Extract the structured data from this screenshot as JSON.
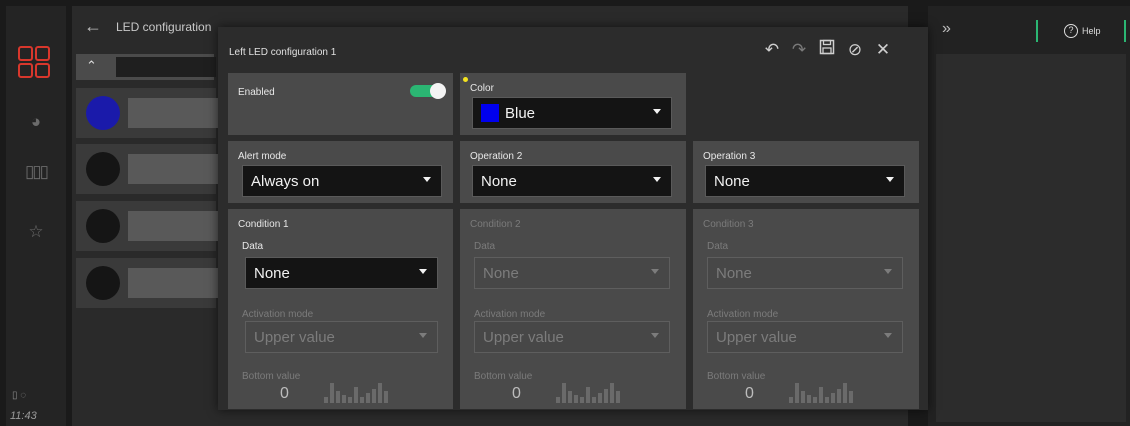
{
  "rail": {
    "clock": "11:43",
    "status": "▯ ◌"
  },
  "background": {
    "title": "LED configuration",
    "led_colors": [
      "#1a1aaa",
      "#151515",
      "#151515",
      "#151515"
    ]
  },
  "right_panel": {
    "help_label": "Help"
  },
  "modal": {
    "title": "Left LED configuration 1",
    "enabled": {
      "label": "Enabled",
      "value": true
    },
    "color": {
      "label": "Color",
      "value": "Blue",
      "swatch": "#0000ee"
    },
    "alert_mode": {
      "label": "Alert mode",
      "value": "Always on"
    },
    "operation2": {
      "label": "Operation 2",
      "value": "None"
    },
    "operation3": {
      "label": "Operation 3",
      "value": "None"
    },
    "conditions": [
      {
        "title": "Condition 1",
        "data_label": "Data",
        "data_value": "None",
        "activation_label": "Activation mode",
        "activation_value": "Upper value",
        "bottom_label": "Bottom value",
        "bottom_value": "0",
        "enabled": true
      },
      {
        "title": "Condition 2",
        "data_label": "Data",
        "data_value": "None",
        "activation_label": "Activation mode",
        "activation_value": "Upper value",
        "bottom_label": "Bottom value",
        "bottom_value": "0",
        "enabled": false
      },
      {
        "title": "Condition 3",
        "data_label": "Data",
        "data_value": "None",
        "activation_label": "Activation mode",
        "activation_value": "Upper value",
        "bottom_label": "Bottom value",
        "bottom_value": "0",
        "enabled": false
      }
    ]
  },
  "colors": {
    "accent": "#2bb673",
    "brand": "#d8372c",
    "indicator": "#f4e31f"
  }
}
